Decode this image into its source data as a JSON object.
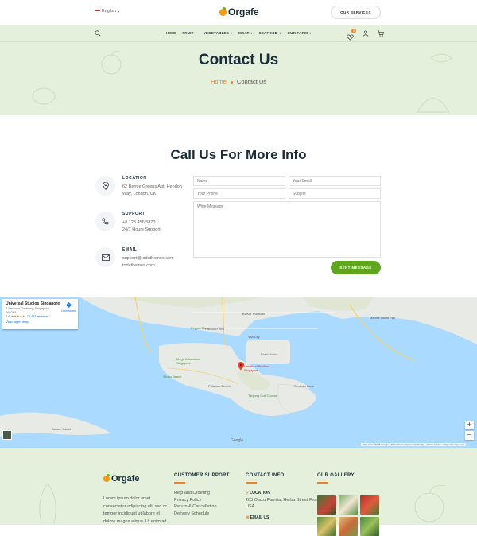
{
  "header": {
    "language": "English",
    "brand": "Orgafe",
    "services_button": "OUR SERVICES"
  },
  "nav": {
    "items": [
      {
        "label": "HOME",
        "has_menu": false
      },
      {
        "label": "FRUIT",
        "has_menu": true
      },
      {
        "label": "VEGETABLES",
        "has_menu": true
      },
      {
        "label": "MEAT",
        "has_menu": true
      },
      {
        "label": "SEAFOOD",
        "has_menu": true
      },
      {
        "label": "OUR FARM",
        "has_menu": true
      }
    ],
    "wishlist_count": "0"
  },
  "hero": {
    "title": "Contact Us",
    "breadcrumb_home": "Home",
    "breadcrumb_current": "Contact Us"
  },
  "contact": {
    "title": "Call Us For More Info",
    "location_title": "LOCATION",
    "location_line1": "62 Bernie Greens Apt. Hendon",
    "location_line2": "Way, London, UK",
    "support_title": "SUPPORT",
    "support_line1": "+8 123 456 5870",
    "support_line2": "24/7 Hours Support",
    "email_title": "EMAIL",
    "email_line1": "support@todathemes.com",
    "email_line2": "todathemes.com"
  },
  "form": {
    "name": "Name",
    "email": "Your Email",
    "phone": "Your Phone",
    "subject": "Subject",
    "message": "Write Message",
    "submit": "SENT MESSAGE"
  },
  "map": {
    "place_name": "Universal Studios Singapore",
    "address_line1": "8 Sentosa Gateway, Singapore",
    "address_line2": "098269",
    "rating": "4.6",
    "stars": "★★★★★",
    "reviews": "75,481 reviews",
    "larger_map": "View larger map",
    "directions": "Directions",
    "pin_label": "Universal Studios Singapore",
    "attribution": "Map data ©2025 Google, Urban Redevelopment Authority",
    "terms": "Terms of Use",
    "report": "Report a map error",
    "zoom_in": "+",
    "zoom_out": "−",
    "labels": {
      "harbourfront": "HarbourFront",
      "bukit": "BUKIT PURMEI",
      "vivocity": "VivoCity",
      "sentosa_cove": "Sentosa Cove",
      "tanjong": "Tanjong Golf Course",
      "palawan": "Palawan Beach",
      "siloso": "Siloso Beach",
      "megazip": "Mega Adventure Singapore",
      "keppel": "Keppel Club",
      "bukom": "Bukom Island",
      "brani": "Brani Island",
      "kennel": "Marina South Pier",
      "resorts": "Resorts World Sentosa"
    }
  },
  "footer": {
    "brand": "Orgafe",
    "about_line1": "Lorem ipsum dolor amet",
    "about_line2": "consectetur adipiscing elit sed do eiusmod",
    "about_line3": "tempor incididunt ut labore et",
    "about_line4": "dolore magna aliqua. Ut enim ad",
    "support_title": "CUSTOMER SUPPORT",
    "support_links": [
      "Help and Ordering",
      "Privacy Policy",
      "Return & Cancellation",
      "Delivery Schedule"
    ],
    "info_title": "CONTACT INFO",
    "info_location_title": "LOCATION",
    "info_location": "205 Olazu Familia, Herba Street Front",
    "info_country": "USA",
    "info_email_title": "EMAIL US",
    "gallery_title": "OUR GALLERY"
  },
  "colors": {
    "accent": "#e9822c",
    "green": "#5fa51e",
    "hero_bg": "#e4f0dc"
  }
}
